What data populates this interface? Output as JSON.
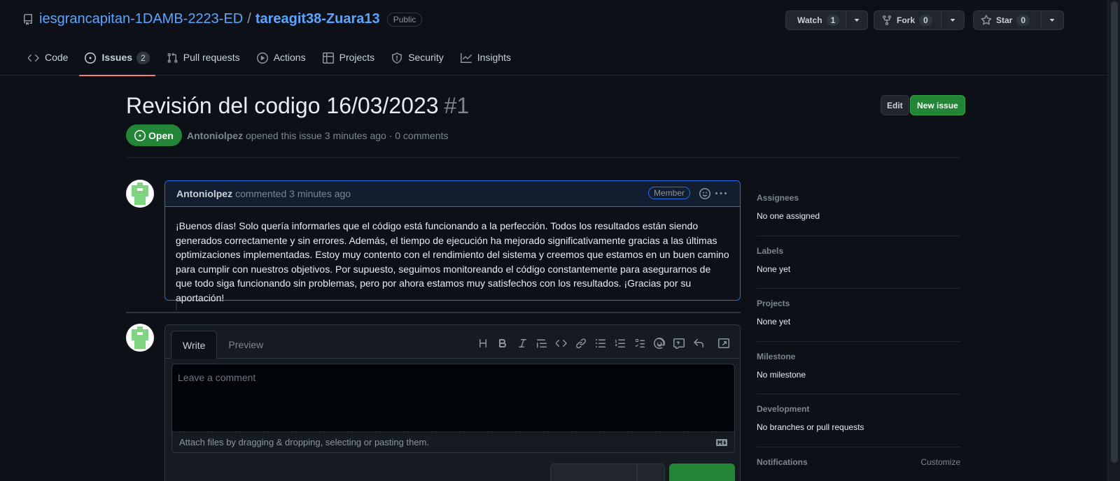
{
  "repo": {
    "owner": "iesgrancapitan-1DAMB-2223-ED",
    "separator": "/",
    "name": "tareagit38-Zuara13",
    "visibility": "Public"
  },
  "actions": {
    "watch_label": "Watch",
    "watch_count": "1",
    "fork_label": "Fork",
    "fork_count": "0",
    "star_label": "Star",
    "star_count": "0"
  },
  "tabs": [
    {
      "label": "Code",
      "icon": "code-icon"
    },
    {
      "label": "Issues",
      "count": "2",
      "icon": "issue-icon",
      "active": true
    },
    {
      "label": "Pull requests",
      "icon": "pull-request-icon"
    },
    {
      "label": "Actions",
      "icon": "play-icon"
    },
    {
      "label": "Projects",
      "icon": "table-icon"
    },
    {
      "label": "Security",
      "icon": "shield-icon"
    },
    {
      "label": "Insights",
      "icon": "graph-icon"
    }
  ],
  "issue": {
    "title": "Revisión del codigo 16/03/2023",
    "number": "#1",
    "state": "Open",
    "author": "Antoniolpez",
    "meta_rest": "opened this issue 3 minutes ago · 0 comments",
    "edit_label": "Edit",
    "new_label": "New issue"
  },
  "comment": {
    "author": "Antoniolpez",
    "time": "commented 3 minutes ago",
    "role": "Member",
    "body": "¡Buenos días! Solo quería informarles que el código está funcionando a la perfección. Todos los resultados están siendo generados correctamente y sin errores. Además, el tiempo de ejecución ha mejorado significativamente gracias a las últimas optimizaciones implementadas. Estoy muy contento con el rendimiento del sistema y creemos que estamos en un buen camino para cumplir con nuestros objetivos. Por supuesto, seguimos monitoreando el código constantemente para asegurarnos de que todo siga funcionando sin problemas, pero por ahora estamos muy satisfechos con los resultados. ¡Gracias por su aportación!"
  },
  "editor": {
    "write_tab": "Write",
    "preview_tab": "Preview",
    "placeholder": "Leave a comment",
    "attach_text": "Attach files by dragging & dropping, selecting or pasting them.",
    "toolbar": [
      "heading-icon",
      "bold-icon",
      "italic-icon",
      "quote-icon",
      "code-icon",
      "link-icon",
      "bulleted-list-icon",
      "numbered-list-icon",
      "task-list-icon",
      "mention-icon",
      "reference-icon",
      "reply-icon",
      "fullscreen-icon"
    ]
  },
  "sidebar": {
    "assignees_label": "Assignees",
    "assignees_value": "No one assigned",
    "labels_label": "Labels",
    "labels_value": "None yet",
    "projects_label": "Projects",
    "projects_value": "None yet",
    "milestone_label": "Milestone",
    "milestone_value": "No milestone",
    "development_label": "Development",
    "development_value": "No branches or pull requests",
    "notifications_label": "Notifications",
    "customize_label": "Customize"
  },
  "colors": {
    "background": "#0d1117",
    "link": "#58a6ff",
    "open_green": "#238636",
    "accent_border": "#1f6feb",
    "active_tab": "#f78166"
  }
}
